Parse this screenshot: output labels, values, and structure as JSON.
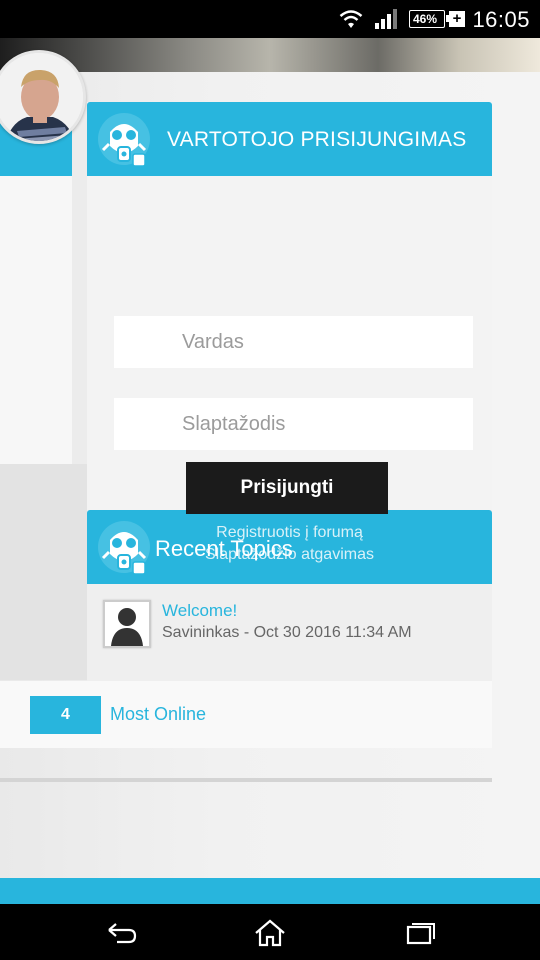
{
  "status_bar": {
    "time": "16:05",
    "battery": "46%",
    "charging_symbol": "+",
    "icons": [
      "wifi-icon",
      "signal-icon",
      "battery-icon",
      "charging-icon"
    ]
  },
  "login": {
    "title": "VARTOTOJO PRISIJUNGIMAS",
    "username_placeholder": "Vardas",
    "password_placeholder": "Slaptažodis",
    "submit_label": "Prisijungti",
    "register_link": "Registruotis į forumą",
    "recover_link": "Slaptažodžio atgavimas"
  },
  "recent_topics": {
    "title": "Recent Topics",
    "items": [
      {
        "title": "Welcome!",
        "meta": "Savininkas - Oct 30 2016 11:34 AM"
      }
    ]
  },
  "stats": {
    "most_online_count": "4",
    "most_online_label": "Most Online"
  },
  "colors": {
    "accent": "#28b5dd",
    "button_dark": "#1b1b1b",
    "panel_bg": "#f3f3f3"
  },
  "nav": {
    "icons": [
      "back-icon",
      "home-icon",
      "recents-icon"
    ]
  }
}
